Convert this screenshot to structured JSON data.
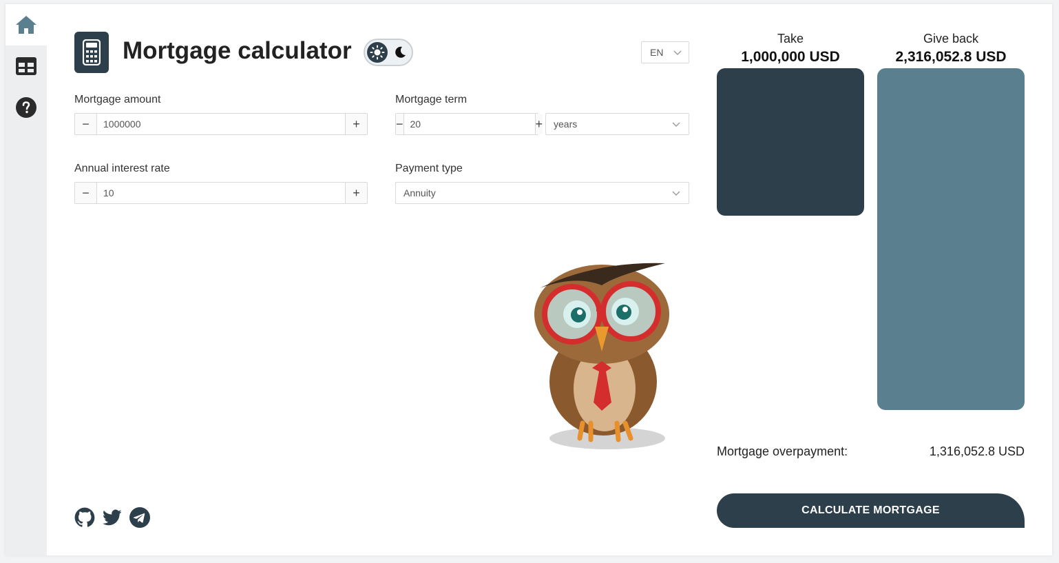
{
  "header": {
    "title": "Mortgage calculator",
    "language": "EN"
  },
  "sidebar": {
    "items": [
      {
        "icon": "home-icon",
        "active": true
      },
      {
        "icon": "table-icon",
        "active": false
      },
      {
        "icon": "help-icon",
        "active": false
      }
    ]
  },
  "form": {
    "amount": {
      "label": "Mortgage amount",
      "value": "1000000"
    },
    "term": {
      "label": "Mortgage term",
      "value": "20",
      "unit": "years"
    },
    "rate": {
      "label": "Annual interest rate",
      "value": "10"
    },
    "payment_type": {
      "label": "Payment type",
      "value": "Annuity"
    }
  },
  "results": {
    "take_label": "Take",
    "take_value": "1,000,000 USD",
    "give_label": "Give back",
    "give_value": "2,316,052.8 USD",
    "overpayment_label": "Mortgage overpayment:",
    "overpayment_value": "1,316,052.8 USD"
  },
  "chart_data": {
    "type": "bar",
    "categories": [
      "Take",
      "Give back"
    ],
    "values": [
      1000000,
      2316052.8
    ],
    "colors": [
      "#2e3f4c",
      "#5a7f8f"
    ],
    "title": "",
    "xlabel": "",
    "ylabel": ""
  },
  "actions": {
    "calculate_label": "CALCULATE MORTGAGE"
  },
  "colors": {
    "accent": "#2e3f4c",
    "secondary": "#5a7f8f",
    "home_icon": "#5a7f8f"
  }
}
